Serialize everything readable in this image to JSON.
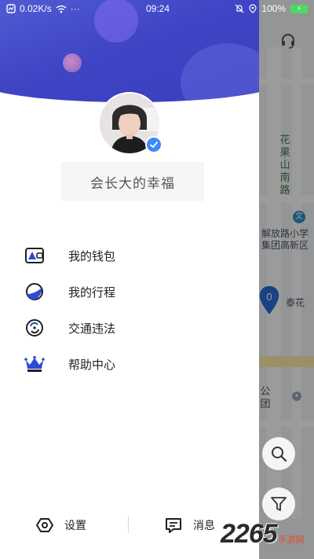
{
  "status_bar": {
    "speed": "0.02K/s",
    "more": "···",
    "time": "09:24",
    "battery_pct": "100%"
  },
  "map": {
    "street_vertical": "花果山南路",
    "poi_line1": "解放路小学",
    "poi_line2": "集团高新区",
    "pin_count": "0",
    "partial_label_1": "泰花",
    "partial_label_2": "公团"
  },
  "profile": {
    "username": "会长大的幸福"
  },
  "menu": {
    "items": [
      {
        "label": "我的钱包",
        "icon": "wallet-icon"
      },
      {
        "label": "我的行程",
        "icon": "trip-icon"
      },
      {
        "label": "交通违法",
        "icon": "violation-icon"
      },
      {
        "label": "帮助中心",
        "icon": "crown-icon"
      }
    ]
  },
  "bottom": {
    "settings_label": "设置",
    "messages_label": "消息"
  },
  "watermark": {
    "number": "2265",
    "text": "手游网"
  },
  "colors": {
    "brand_blue": "#3e44c4",
    "verified_blue": "#3d8af7",
    "watermark_red": "#e34b2b"
  }
}
